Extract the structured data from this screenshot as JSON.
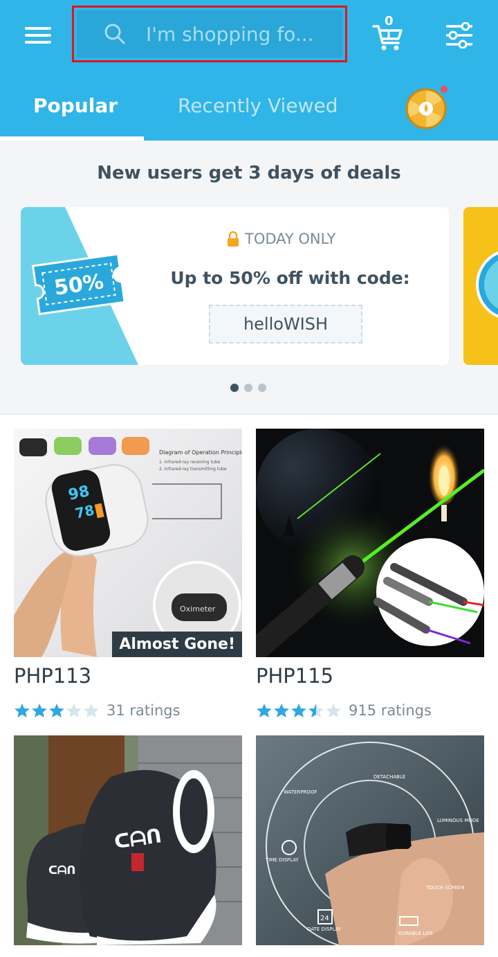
{
  "header": {
    "search": {
      "placeholder": "I'm shopping fo..."
    },
    "cart": {
      "count": "0"
    },
    "tabs": [
      {
        "label": "Popular",
        "active": true
      },
      {
        "label": "Recently Viewed",
        "active": false
      }
    ],
    "accent_color": "#2fb5e7"
  },
  "deals": {
    "title": "New users get 3 days of deals",
    "promo": {
      "badge_text": "50%",
      "tag": "TODAY ONLY",
      "headline": "Up to 50% off with code:",
      "code": "helloWISH"
    },
    "carousel_dots": 3,
    "active_dot": 0
  },
  "products": [
    {
      "price": "PHP113",
      "rating": 3,
      "ratings_label": "31 ratings",
      "badge": "Almost Gone!",
      "image": "pulse-oximeter"
    },
    {
      "price": "PHP115",
      "rating": 3.5,
      "ratings_label": "915 ratings",
      "badge": "",
      "image": "green-laser-pointer"
    },
    {
      "price": "",
      "rating": null,
      "ratings_label": "",
      "badge": "",
      "image": "black-sneakers"
    },
    {
      "price": "",
      "rating": null,
      "ratings_label": "",
      "badge": "",
      "image": "smart-band"
    }
  ],
  "smartband_features": [
    "WATERPROOF",
    "DETACHABLE",
    "LUMINOUS MODE",
    "TIME DISPLAY",
    "TOUCH SCREEN",
    "DATE DISPLAY",
    "DURABLE LIFE"
  ],
  "smartband_date": "24",
  "oximeter_text": {
    "diagram_title": "Diagram of Operation Principle",
    "diagram_line1": "1. Infrared-ray receiving tube",
    "diagram_line2": "2. Infrared-ray transmitting tube",
    "spo2": "98",
    "bpm": "78",
    "case_label": "Oximeter"
  },
  "sneaker_logo": "ᑕᗩᑎ"
}
